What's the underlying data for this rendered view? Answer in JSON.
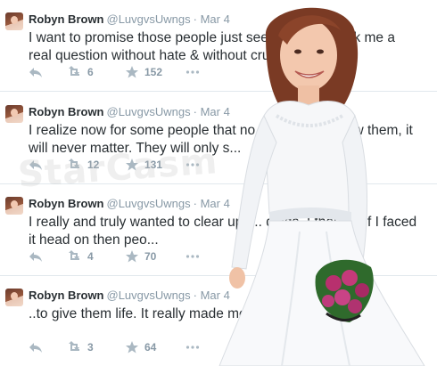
{
  "tweets": [
    {
      "name": "Robyn Brown",
      "handle": "@LuvgvsUwngs",
      "date": "· Mar 4",
      "text": "I want to promise those people just seeking ... hey ask me a real question without hate & without cruelty, ... swer.",
      "retweets": "6",
      "favorites": "152"
    },
    {
      "name": "Robyn Brown",
      "handle": "@LuvgvsUwngs",
      "date": "· Mar 4",
      "text": "I realize now for some people that no matt ... you show them, it will never matter.  They will only s...",
      "retweets": "12",
      "favorites": "131"
    },
    {
      "name": "Robyn Brown",
      "handle": "@LuvgvsUwngs",
      "date": "· Mar 4",
      "text": "I really and truly wanted to clear up r... dings.  I thought if I faced it head on then peo...",
      "retweets": "4",
      "favorites": "70"
    },
    {
      "name": "Robyn Brown",
      "handle": "@LuvgvsUwngs",
      "date": "· Mar 4",
      "text": "..to give them life.  It really made me ... faith in mankind.",
      "retweets": "3",
      "favorites": "64"
    }
  ],
  "watermark": "StarCasm",
  "icons": {
    "reply": "reply-icon",
    "retweet": "retweet-icon",
    "favorite": "star-icon",
    "more": "more-icon"
  },
  "colors": {
    "text": "#292f33",
    "muted": "#8899a6",
    "divider": "#e1e8ed"
  }
}
